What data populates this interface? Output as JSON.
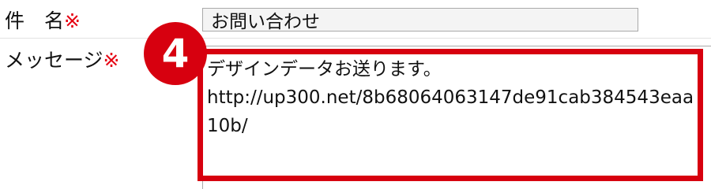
{
  "form": {
    "subject": {
      "label_text": "件　名",
      "required_mark": "※",
      "value": "お問い合わせ"
    },
    "message": {
      "label_text": "メッセージ",
      "required_mark": "※",
      "value": "デザインデータお送ります。\nhttp://up300.net/8b68064063147de91cab384543eaa10b/"
    }
  },
  "annotation": {
    "step_number": "4",
    "highlight_color": "#d7000f"
  },
  "colors": {
    "required_mark": "#e60012",
    "input_border": "#a9a9a9",
    "input_background": "#f4f4f4"
  }
}
